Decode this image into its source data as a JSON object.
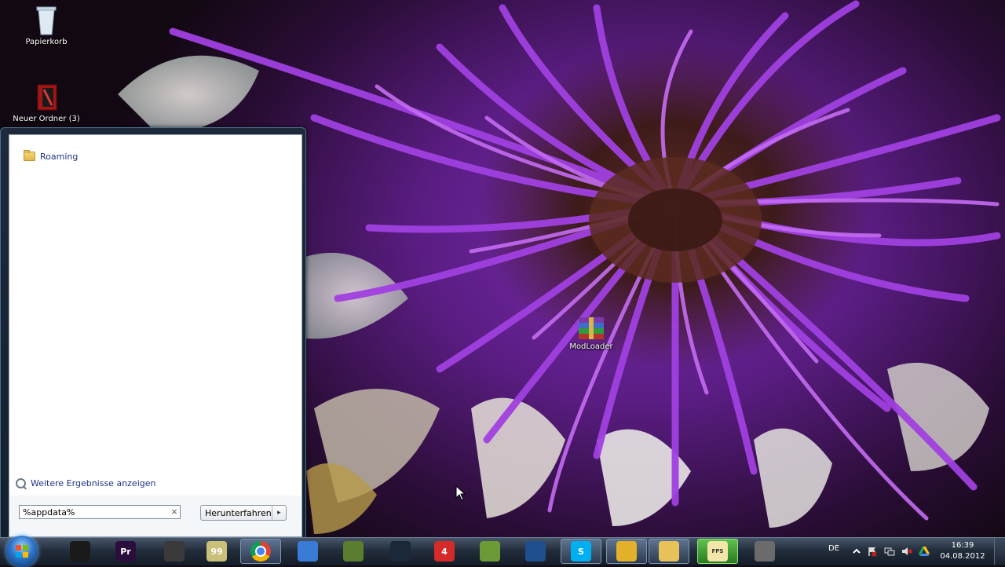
{
  "desktop": {
    "icons": [
      {
        "label": "Papierkorb",
        "icon": "recycle-bin-icon"
      },
      {
        "label": "Neuer Ordner (3)",
        "icon": "folder-app-icon"
      },
      {
        "label": "ModLoader",
        "icon": "winrar-archive-icon"
      }
    ]
  },
  "start_menu": {
    "results": [
      {
        "label": "Roaming",
        "icon": "folder-icon"
      }
    ],
    "more_results": "Weitere Ergebnisse anzeigen",
    "search": {
      "value": "%appdata%",
      "clear_glyph": "×"
    },
    "shutdown": {
      "label": "Herunterfahren",
      "arrow": "▸"
    }
  },
  "taskbar": {
    "pinned": [
      {
        "icon": "video-camera-icon",
        "color": "#1a1a1a"
      },
      {
        "icon": "premiere-pro-icon",
        "color": "#2a0f3d",
        "label": "Pr"
      },
      {
        "icon": "scissors-icon",
        "color": "#3a3a3a"
      },
      {
        "icon": "notepad-icon",
        "color": "#c9c07a",
        "label": "99"
      },
      {
        "icon": "chrome-icon",
        "color": "#d8382f"
      },
      {
        "icon": "thunderbird-icon",
        "color": "#3a7bd5"
      },
      {
        "icon": "minecraft-block-icon",
        "color": "#5b7d2f"
      },
      {
        "icon": "steam-icon",
        "color": "#1b2838"
      },
      {
        "icon": "pro7-icon",
        "color": "#d42a2a",
        "label": "4"
      },
      {
        "icon": "minecraft-block-icon",
        "color": "#6b9a36"
      },
      {
        "icon": "remote-desktop-icon",
        "color": "#1f4f8f"
      },
      {
        "icon": "skype-icon",
        "color": "#00aff0",
        "label": "S"
      },
      {
        "icon": "winamp-icon",
        "color": "#e2b02a"
      },
      {
        "icon": "explorer-folder-icon",
        "color": "#e7c25a"
      },
      {
        "icon": "fraps-icon",
        "color": "#f2e6a8",
        "label": "FPS"
      },
      {
        "icon": "modloader-icon",
        "color": "#6b6b6b"
      }
    ]
  },
  "tray": {
    "language": "DE",
    "time": "16:39",
    "date": "04.08.2012"
  }
}
